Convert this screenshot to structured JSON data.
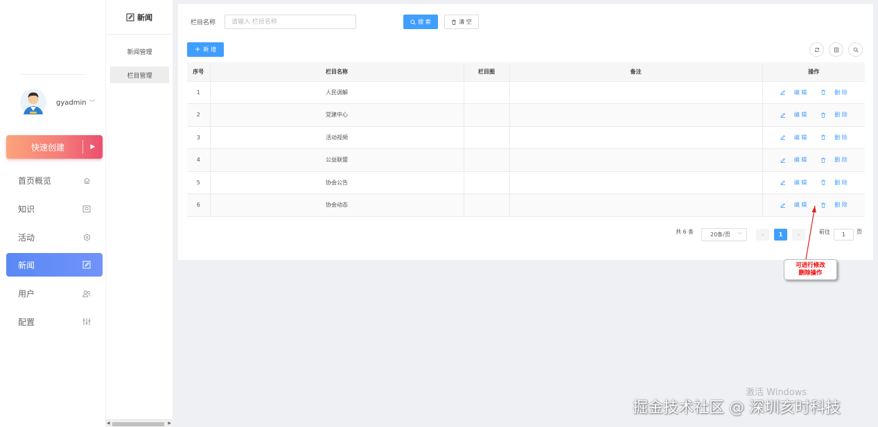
{
  "user": {
    "name": "gyadmin"
  },
  "quick_create": {
    "label": "快速创建"
  },
  "nav": [
    {
      "label": "首页概览",
      "icon": "home-icon"
    },
    {
      "label": "知识",
      "icon": "book-icon"
    },
    {
      "label": "活动",
      "icon": "settings-icon"
    },
    {
      "label": "新闻",
      "icon": "edit-icon",
      "active": true
    },
    {
      "label": "用户",
      "icon": "users-icon"
    },
    {
      "label": "配置",
      "icon": "sliders-icon"
    }
  ],
  "subnav": {
    "title": "新闻",
    "items": [
      {
        "label": "新闻管理"
      },
      {
        "label": "栏目管理",
        "active": true
      }
    ]
  },
  "filter": {
    "label": "栏目名称",
    "placeholder": "请输入 栏目名称",
    "search_label": "搜 索",
    "clear_label": "清 空"
  },
  "toolbar": {
    "add_label": "新 增"
  },
  "table": {
    "headers": {
      "index": "序号",
      "name": "栏目名称",
      "image": "栏目图",
      "remark": "备注",
      "ops": "操作"
    },
    "rows": [
      {
        "index": "1",
        "name": "人民调解",
        "image": "",
        "remark": ""
      },
      {
        "index": "2",
        "name": "党建中心",
        "image": "",
        "remark": ""
      },
      {
        "index": "3",
        "name": "活动视频",
        "image": "",
        "remark": ""
      },
      {
        "index": "4",
        "name": "公益联盟",
        "image": "",
        "remark": ""
      },
      {
        "index": "5",
        "name": "协会公告",
        "image": "",
        "remark": ""
      },
      {
        "index": "6",
        "name": "协会动态",
        "image": "",
        "remark": ""
      }
    ],
    "edit_label": "编 辑",
    "delete_label": "删 除"
  },
  "pagination": {
    "total": "共 6 条",
    "page_size": "20条/页",
    "current": "1",
    "goto_prefix": "前往",
    "goto_value": "1",
    "goto_suffix": "页"
  },
  "annotation": {
    "line1": "可进行修改",
    "line2": "删除操作"
  },
  "watermarks": {
    "windows": "激活 Windows",
    "footer": "掘金技术社区 @ 深圳亥时科技"
  },
  "colors": {
    "primary": "#409eff",
    "active_nav": "#5a88f5",
    "quick_start": "#fba47a",
    "quick_end": "#ea4f6d",
    "annotation": "#e00000"
  }
}
